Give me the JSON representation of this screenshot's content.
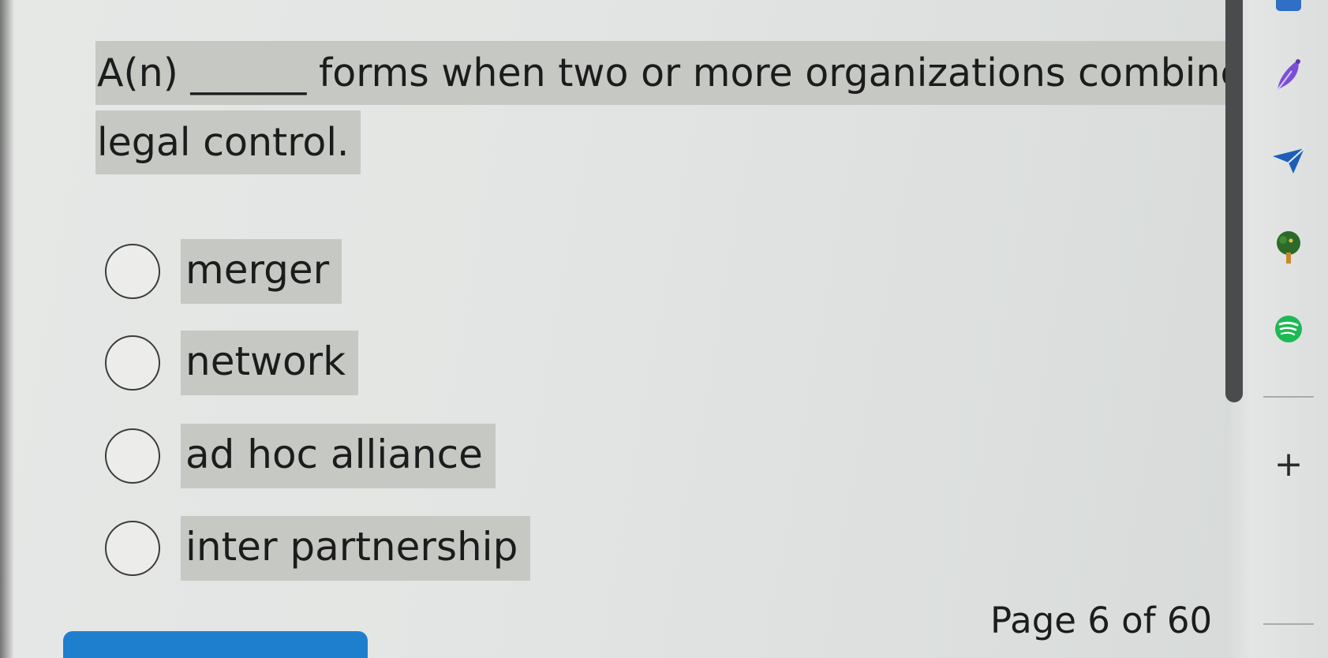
{
  "question": {
    "line1": "A(n) ______ forms when two or more organizations combine",
    "line2": "legal control."
  },
  "options": [
    {
      "label": "merger",
      "selected": false
    },
    {
      "label": "network",
      "selected": false
    },
    {
      "label": "ad hoc alliance",
      "selected": false
    },
    {
      "label": "inter partnership",
      "selected": false
    }
  ],
  "pagination": {
    "text": "Page 6 of 60"
  },
  "sidebar": {
    "icons": [
      "app-icon",
      "feather-icon",
      "send-icon",
      "tree-icon",
      "spotify-icon"
    ],
    "add_label": "+"
  },
  "colors": {
    "highlight": "#c6c8c4",
    "primary_button": "#1f7fcf",
    "scrollbar_thumb": "#4a4b4c",
    "spotify": "#1db954",
    "feather": "#7a4fd6"
  }
}
